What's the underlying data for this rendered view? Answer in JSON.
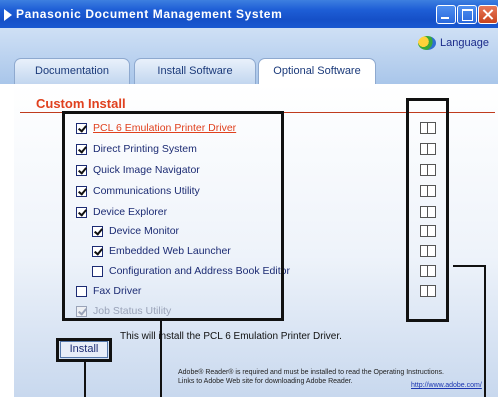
{
  "window": {
    "title": "Panasonic Document Management System"
  },
  "header": {
    "language_label": "Language"
  },
  "tabs": [
    {
      "label": "Documentation"
    },
    {
      "label": "Install Software"
    },
    {
      "label": "Optional Software"
    }
  ],
  "section": {
    "title": "Custom Install"
  },
  "options": [
    {
      "label": "PCL 6 Emulation Printer Driver",
      "checked": true
    },
    {
      "label": "Direct Printing System",
      "checked": true
    },
    {
      "label": "Quick Image Navigator",
      "checked": true
    },
    {
      "label": "Communications Utility",
      "checked": true
    },
    {
      "label": "Device Explorer",
      "checked": true
    },
    {
      "label": "Device Monitor",
      "checked": true
    },
    {
      "label": "Embedded Web Launcher",
      "checked": true
    },
    {
      "label": "Configuration and Address Book Editor",
      "checked": false
    },
    {
      "label": "Fax Driver",
      "checked": false
    },
    {
      "label": "Job Status Utility",
      "checked": true,
      "disabled": true
    }
  ],
  "description": "This will install the PCL 6 Emulation Printer Driver.",
  "install_button": "Install",
  "footer": {
    "note_line1": "Adobe® Reader® is required and must be installed to read the Operating Instructions.",
    "note_line2": "Links to Adobe Web site for downloading Adobe Reader.",
    "link": "http://www.adobe.com/"
  },
  "colors": {
    "accent_red": "#e0401e",
    "titlebar_blue": "#1e5ed6",
    "text_blue": "#1c2b73"
  }
}
